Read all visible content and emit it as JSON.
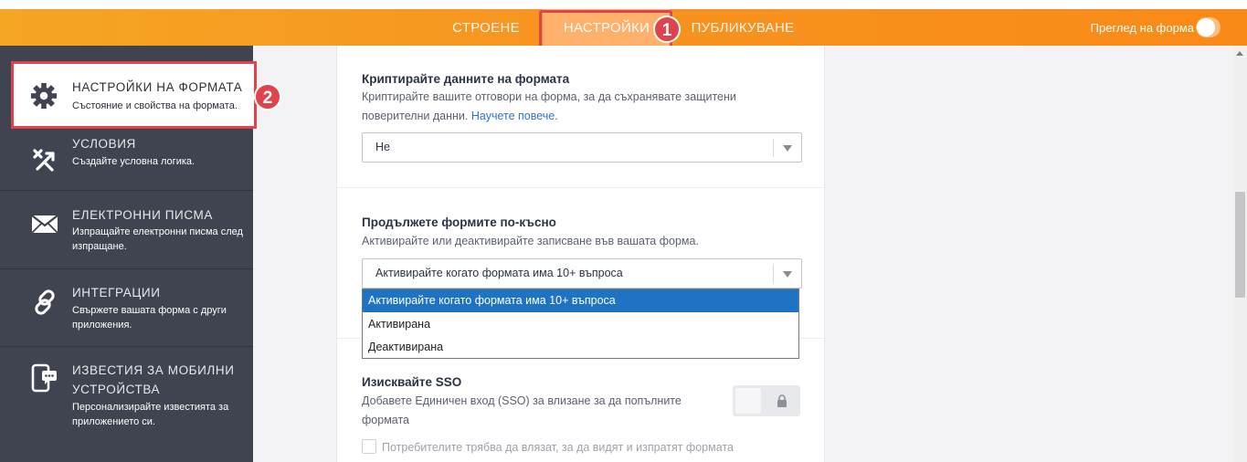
{
  "topbar": {
    "tabs": [
      {
        "label": "СТРОЕНЕ"
      },
      {
        "label": "НАСТРОЙКИ"
      },
      {
        "label": "ПУБЛИКУВАНЕ"
      }
    ],
    "preview_label": "Преглед на форма",
    "preview_toggle_on": false,
    "accent_color": "#f79420",
    "markers": [
      "1",
      "2"
    ]
  },
  "sidebar": {
    "active": {
      "title": "НАСТРОЙКИ НА ФОРМАТА",
      "subtitle": "Състояние и свойства на формата.",
      "icon": "gear-icon"
    },
    "items": [
      {
        "title": "УСЛОВИЯ",
        "subtitle": "Създайте условна логика.",
        "icon": "conditions-icon"
      },
      {
        "title": "ЕЛЕКТРОННИ ПИСМА",
        "subtitle": "Изпращайте електронни писма след изпращане.",
        "icon": "envelope-icon"
      },
      {
        "title": "ИНТЕГРАЦИИ",
        "subtitle": "Свържете вашата форма с други приложения.",
        "icon": "link-icon"
      },
      {
        "title": "ИЗВЕСТИЯ ЗА МОБИЛНИ УСТРОЙСТВА",
        "subtitle": "Персонализирайте известията за приложението си.",
        "icon": "mobile-notification-icon"
      }
    ]
  },
  "settings": {
    "encrypt": {
      "label": "Криптирайте данните на формата",
      "desc_line1": "Криптирайте вашите отговори на форма, за да съхранявате защитени",
      "desc_line2": "поверителни данни.",
      "link": "Научете повече.",
      "value": "Не"
    },
    "continue_later": {
      "label": "Продължете формите по-късно",
      "desc": "Активирайте или деактивирайте записване във вашата форма.",
      "value": "Активирайте когато формата има 10+ въпроса",
      "options": [
        "Активирайте когато формата има 10+ въпроса",
        "Активирана",
        "Деактивирана"
      ]
    },
    "sso": {
      "label": "Изисквайте SSO",
      "desc_line1": "Добавете Единичен вход (SSO) за влизане за да попълните",
      "desc_line2": "формата",
      "locked": true,
      "checkbox_label": "Потребителите трябва да влязат, за да видят и изпратят формата"
    }
  }
}
